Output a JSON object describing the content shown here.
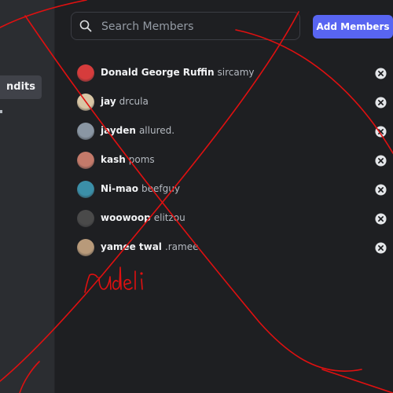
{
  "sidebar": {
    "active_item_label": "ndits"
  },
  "search": {
    "placeholder": "Search Members",
    "icon": "search-icon"
  },
  "add_members_label": "Add Members",
  "members": [
    {
      "display_name": "Donald George Ruffin",
      "username": "sircamy",
      "avatar_color": "#d63c3c"
    },
    {
      "display_name": "jay",
      "username": "drcula",
      "avatar_color": "#d9c6a5"
    },
    {
      "display_name": "jayden",
      "username": "allured.",
      "avatar_color": "#8a96a3"
    },
    {
      "display_name": "kash",
      "username": "poms",
      "avatar_color": "#c47a6a"
    },
    {
      "display_name": "Ni-mao",
      "username": "beefguy",
      "avatar_color": "#3b8fa8"
    },
    {
      "display_name": "woowoop",
      "username": "elitzou",
      "avatar_color": "#4a4a4a"
    },
    {
      "display_name": "yamee twal",
      "username": ".ramee",
      "avatar_color": "#b89a7a"
    }
  ],
  "remove_icon": "remove-circle-icon",
  "annotation": {
    "handwritten_text": "rudeli",
    "ink_color": "#e01010"
  }
}
